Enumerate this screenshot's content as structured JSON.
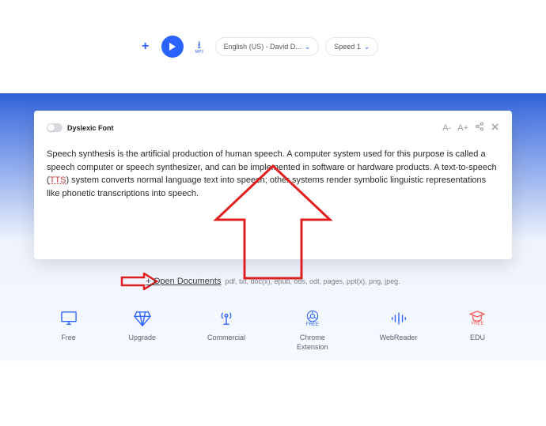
{
  "toolbar": {
    "plus": "+",
    "mp3_label": "MP3",
    "voice": "English (US) - David D...",
    "speed": "Speed 1"
  },
  "card": {
    "dyslexic_label": "Dyslexic Font",
    "font_dec": "A-",
    "font_inc": "A+",
    "share": "share",
    "close": "close",
    "body_before": "Speech synthesis is the artificial production of human speech. A computer system used for this purpose is called a speech computer or speech synthesizer, and can be implemented in software or hardware products. A text-to-speech (",
    "body_link": "TTS",
    "body_after": ") system converts normal language text into speech; other systems render symbolic linguistic representations like phonetic transcriptions into speech."
  },
  "open": {
    "link": "+ Open Documents",
    "ext": "pdf, txt, doc(x), epub, ods, odt, pages, ppt(x), png, jpeg."
  },
  "icons": {
    "free": "Free",
    "upgrade": "Upgrade",
    "commercial": "Commercial",
    "chrome": "Chrome\nExtension",
    "chrome_badge": "FREE",
    "webreader": "WebReader",
    "edu": "EDU",
    "edu_badge": "FREE"
  }
}
